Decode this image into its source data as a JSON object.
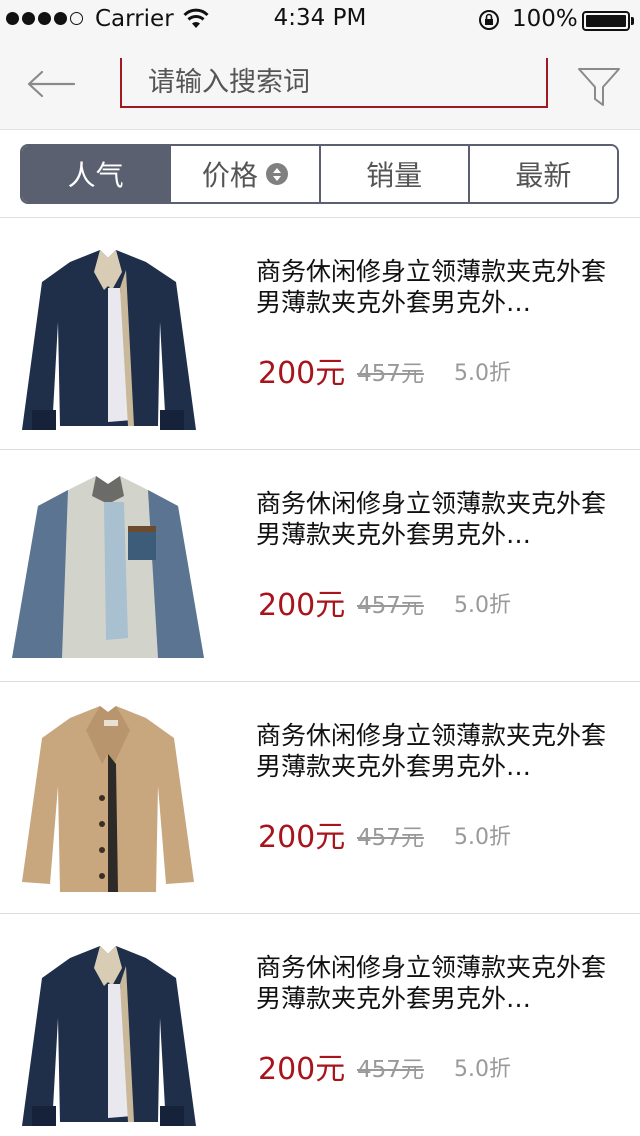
{
  "status_bar": {
    "carrier": "Carrier",
    "time": "4:34 PM",
    "battery": "100%"
  },
  "navbar": {
    "back_icon": "arrow-left-icon",
    "search_placeholder": "请输入搜索词",
    "filter_icon": "funnel-icon"
  },
  "tabs": [
    {
      "label": "人气",
      "active": true
    },
    {
      "label": "价格",
      "active": false,
      "icon": "sort-icon"
    },
    {
      "label": "销量",
      "active": false
    },
    {
      "label": "最新",
      "active": false
    }
  ],
  "products": [
    {
      "title": "商务休闲修身立领薄款夹克外套男薄款夹克外套男克外…",
      "price": "200元",
      "old_price": "457元",
      "discount": "5.0折",
      "image": "navy-jacket"
    },
    {
      "title": "商务休闲修身立领薄款夹克外套男薄款夹克外套男克外…",
      "price": "200元",
      "old_price": "457元",
      "discount": "5.0折",
      "image": "grey-jacket"
    },
    {
      "title": "商务休闲修身立领薄款夹克外套男薄款夹克外套男克外…",
      "price": "200元",
      "old_price": "457元",
      "discount": "5.0折",
      "image": "khaki-jacket"
    },
    {
      "title": "商务休闲修身立领薄款夹克外套男薄款夹克外套男克外…",
      "price": "200元",
      "old_price": "457元",
      "discount": "5.0折",
      "image": "navy-jacket"
    }
  ],
  "colors": {
    "accent_red": "#a8141b",
    "tab_active": "#5b6070",
    "background": "#f7f6f7"
  }
}
